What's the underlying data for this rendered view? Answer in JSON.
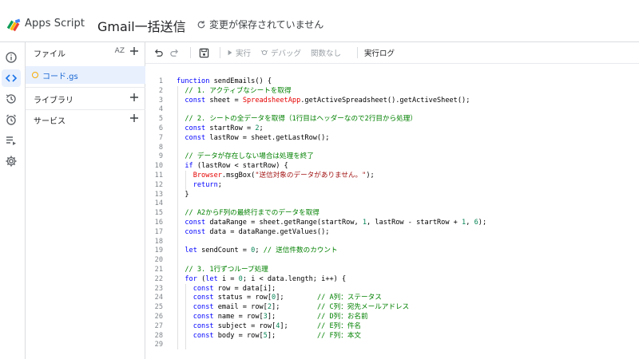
{
  "header": {
    "app_name": "Apps Script",
    "project_title": "Gmail一括送信",
    "save_status": "変更が保存されていません",
    "logo_icon": "apps-script-logo-icon"
  },
  "rail": {
    "items": [
      {
        "name": "overview",
        "icon": "info-icon"
      },
      {
        "name": "editor",
        "icon": "code-icon",
        "active": true
      },
      {
        "name": "executions",
        "icon": "history-icon"
      },
      {
        "name": "triggers",
        "icon": "alarm-icon"
      },
      {
        "name": "executions-list",
        "icon": "list-play-icon"
      },
      {
        "name": "settings",
        "icon": "gear-icon"
      }
    ]
  },
  "panel": {
    "files_label": "ファイル",
    "sort_label": "AZ",
    "file_name": "コード.gs",
    "libraries_label": "ライブラリ",
    "services_label": "サービス"
  },
  "toolbar": {
    "run_label": "実行",
    "debug_label": "デバッグ",
    "function_label": "関数なし",
    "log_label": "実行ログ"
  },
  "code": {
    "lines": [
      "function sendEmails() {",
      "  // 1. アクティブなシートを取得",
      "  const sheet = SpreadsheetApp.getActiveSpreadsheet().getActiveSheet();",
      "",
      "  // 2. シートの全データを取得（1行目はヘッダーなので2行目から処理）",
      "  const startRow = 2;",
      "  const lastRow = sheet.getLastRow();",
      "",
      "  // データが存在しない場合は処理を終了",
      "  if (lastRow < startRow) {",
      "    Browser.msgBox(\"送信対象のデータがありません。\");",
      "    return;",
      "  }",
      "",
      "  // A2からF列の最終行までのデータを取得",
      "  const dataRange = sheet.getRange(startRow, 1, lastRow - startRow + 1, 6);",
      "  const data = dataRange.getValues();",
      "",
      "  let sendCount = 0; // 送信件数のカウント",
      "",
      "  // 3. 1行ずつループ処理",
      "  for (let i = 0; i < data.length; i++) {",
      "    const row = data[i];",
      "    const status = row[0];        // A列：ステータス",
      "    const email = row[2];         // C列：宛先メールアドレス",
      "    const name = row[3];          // D列：お名前",
      "    const subject = row[4];       // E列：件名",
      "    const body = row[5];          // F列：本文",
      ""
    ]
  }
}
